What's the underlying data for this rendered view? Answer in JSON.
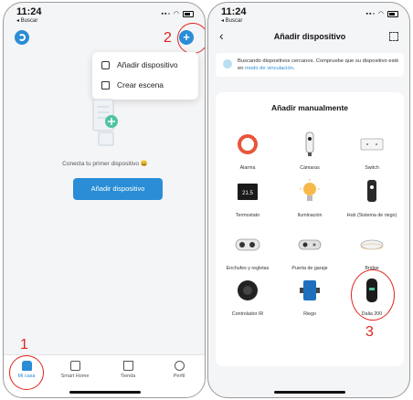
{
  "left_screen": {
    "status": {
      "time": "11:24",
      "back_label": "◂ Buscar"
    },
    "menu": {
      "add_device": "Añadir dispositivo",
      "create_scene": "Crear escena"
    },
    "empty_message": "Conecta tu primer dispositivo 😀",
    "add_button": "Añadir dispositivo",
    "tabs": [
      {
        "label": "Mi casa",
        "icon": "home-icon",
        "active": true
      },
      {
        "label": "Smart Home",
        "icon": "checkbox-icon"
      },
      {
        "label": "Tienda",
        "icon": "bag-icon"
      },
      {
        "label": "Perfil",
        "icon": "profile-icon"
      }
    ],
    "step_markers": {
      "tab": "1",
      "plus": "2"
    }
  },
  "right_screen": {
    "status": {
      "time": "11:24",
      "back_label": "◂ Buscar"
    },
    "title": "Añadir dispositivo",
    "banner_text": "Buscando dispositivos cercanos. Compruebe que su dispositivo esté en ",
    "banner_link": "modo de vinculación",
    "banner_end": ".",
    "section_title": "Añadir manualmente",
    "devices": [
      {
        "label": "Alarma",
        "icon": "alarm-ring-icon"
      },
      {
        "label": "Cámaras",
        "icon": "camera-icon"
      },
      {
        "label": "Switch",
        "icon": "switch-icon"
      },
      {
        "label": "Termostato",
        "icon": "thermostat-icon",
        "display": "21.5"
      },
      {
        "label": "Iluminación",
        "icon": "bulb-icon"
      },
      {
        "label": "Hub (Sistema de riego)",
        "icon": "hub-icon"
      },
      {
        "label": "Enchufes y regletas",
        "icon": "plug-icon"
      },
      {
        "label": "Puerta de garaje",
        "icon": "garage-icon"
      },
      {
        "label": "Bridge",
        "icon": "bridge-icon"
      },
      {
        "label": "Controlador IR",
        "icon": "ir-controller-icon"
      },
      {
        "label": "Riego",
        "icon": "irrigation-icon"
      },
      {
        "label": "Dalia 200",
        "icon": "dalia-icon"
      }
    ],
    "step_marker": "3"
  },
  "colors": {
    "accent": "#2a8dd6",
    "marker": "#e2231a"
  }
}
